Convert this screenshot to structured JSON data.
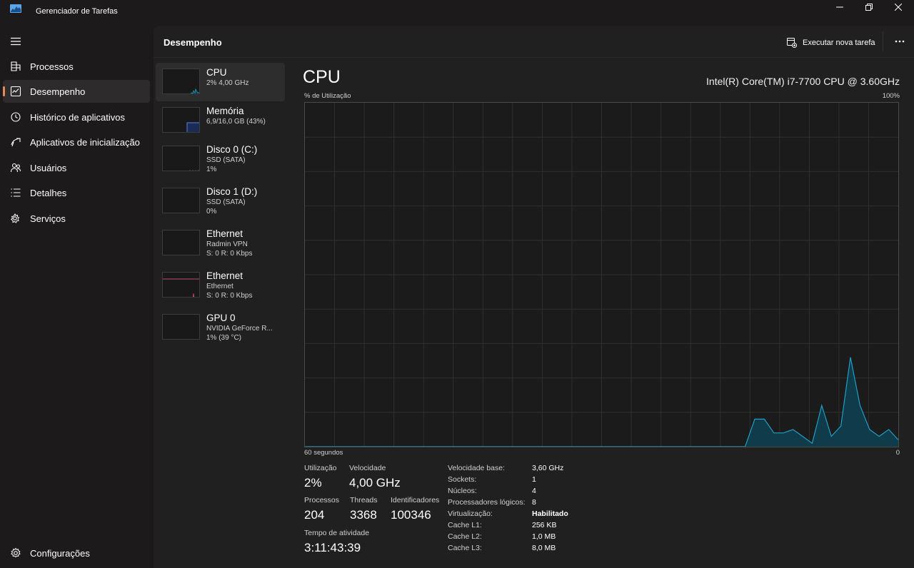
{
  "window": {
    "title": "Gerenciador de Tarefas"
  },
  "sidebar": {
    "items": [
      {
        "label": "Processos",
        "icon": "processes-icon"
      },
      {
        "label": "Desempenho",
        "icon": "performance-icon"
      },
      {
        "label": "Histórico de aplicativos",
        "icon": "history-icon"
      },
      {
        "label": "Aplicativos de inicialização",
        "icon": "startup-icon"
      },
      {
        "label": "Usuários",
        "icon": "users-icon"
      },
      {
        "label": "Detalhes",
        "icon": "details-icon"
      },
      {
        "label": "Serviços",
        "icon": "services-icon"
      }
    ],
    "settings_label": "Configurações"
  },
  "header": {
    "title": "Desempenho",
    "run_task_label": "Executar nova tarefa"
  },
  "devices": [
    {
      "name": "CPU",
      "sub1": "2% 4,00 GHz",
      "sub2": ""
    },
    {
      "name": "Memória",
      "sub1": "6,9/16,0 GB (43%)",
      "sub2": ""
    },
    {
      "name": "Disco 0 (C:)",
      "sub1": "SSD (SATA)",
      "sub2": "1%"
    },
    {
      "name": "Disco 1 (D:)",
      "sub1": "SSD (SATA)",
      "sub2": "0%"
    },
    {
      "name": "Ethernet",
      "sub1": "Radmin VPN",
      "sub2": "S: 0 R: 0 Kbps"
    },
    {
      "name": "Ethernet",
      "sub1": "Ethernet",
      "sub2": "S: 0 R: 0 Kbps"
    },
    {
      "name": "GPU 0",
      "sub1": "NVIDIA GeForce R...",
      "sub2": "1% (39 °C)"
    }
  ],
  "detail": {
    "title": "CPU",
    "model": "Intel(R) Core(TM) i7-7700 CPU @ 3.60GHz",
    "axis_top_left": "% de Utilização",
    "axis_top_right": "100%",
    "axis_bottom_left": "60 segundos",
    "axis_bottom_right": "0",
    "stats": {
      "utilization_label": "Utilização",
      "utilization_value": "2%",
      "speed_label": "Velocidade",
      "speed_value": "4,00 GHz",
      "processes_label": "Processos",
      "processes_value": "204",
      "threads_label": "Threads",
      "threads_value": "3368",
      "handles_label": "Identificadores",
      "handles_value": "100346",
      "uptime_label": "Tempo de atividade",
      "uptime_value": "3:11:43:39"
    },
    "specs": [
      {
        "key": "Velocidade base:",
        "value": "3,60 GHz"
      },
      {
        "key": "Sockets:",
        "value": "1"
      },
      {
        "key": "Núcleos:",
        "value": "4"
      },
      {
        "key": "Processadores lógicos:",
        "value": "8"
      },
      {
        "key": "Virtualização:",
        "value": "Habilitado"
      },
      {
        "key": "Cache L1:",
        "value": "256 KB"
      },
      {
        "key": "Cache L2:",
        "value": "1,0 MB"
      },
      {
        "key": "Cache L3:",
        "value": "8,0 MB"
      }
    ]
  },
  "colors": {
    "cpu_line": "#1e9fc6",
    "cpu_fill": "#0f3b4a",
    "memory_line": "#5b7fd6",
    "disk_line": "#6fa12a",
    "ethernet_line": "#c04a66",
    "accent": "#e38a5f"
  },
  "chart_data": {
    "type": "area",
    "title": "CPU",
    "xlabel": "60 segundos",
    "ylabel": "% de Utilização",
    "xlim": [
      60,
      0
    ],
    "ylim": [
      0,
      100
    ],
    "grid": true,
    "x": [
      60,
      59,
      58,
      57,
      56,
      55,
      54,
      53,
      52,
      51,
      50,
      49,
      48,
      47,
      46,
      45,
      44,
      43,
      42,
      41,
      40,
      39,
      38,
      37,
      36,
      35,
      34,
      33,
      32,
      31,
      30,
      29,
      28,
      27,
      26,
      25,
      24,
      23,
      22,
      21,
      20,
      19,
      18,
      17,
      16,
      15,
      14,
      13,
      12,
      11,
      10,
      9,
      8,
      7,
      6,
      5,
      4,
      3,
      2,
      1,
      0
    ],
    "series": [
      {
        "values": [
          0,
          0,
          0,
          0,
          0,
          0,
          0,
          0,
          0,
          0,
          0,
          0,
          0,
          0,
          0,
          0,
          0,
          0,
          0,
          0,
          0,
          0,
          0,
          0,
          0,
          0,
          0,
          0,
          0,
          0,
          0,
          0,
          0,
          0,
          0,
          0,
          0,
          0,
          0,
          0,
          0,
          0,
          0,
          0,
          0,
          0,
          0,
          8,
          8,
          4,
          4,
          5,
          3,
          1,
          12,
          3,
          6,
          26,
          12,
          5,
          3,
          5,
          2
        ]
      }
    ]
  }
}
